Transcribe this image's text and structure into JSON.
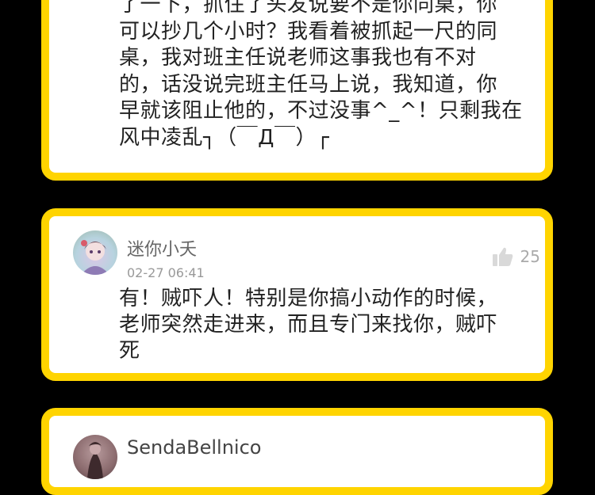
{
  "comments": [
    {
      "text": "了一下，抓住了头发说要不是你同桌，你\n可以抄几个小时？我看着被抓起一尺的同\n桌，我对班主任说老师这事我也有不对\n的，话没说完班主任马上说，我知道，你\n早就该阻止他的，不过没事^_^！只剩我在\n风中凌乱┐（￣Д￣）┌"
    },
    {
      "username": "迷你小夭",
      "timestamp": "02-27 06:41",
      "likes": "25",
      "text": "有！贼吓人！特别是你搞小动作的时候，\n老师突然走进来，而且专门来找你，贼吓\n死"
    },
    {
      "username": "SendaBellnico"
    }
  ],
  "colors": {
    "card_border": "#ffd400",
    "background": "#000000"
  },
  "icons": {
    "like": "thumbs-up-icon"
  }
}
